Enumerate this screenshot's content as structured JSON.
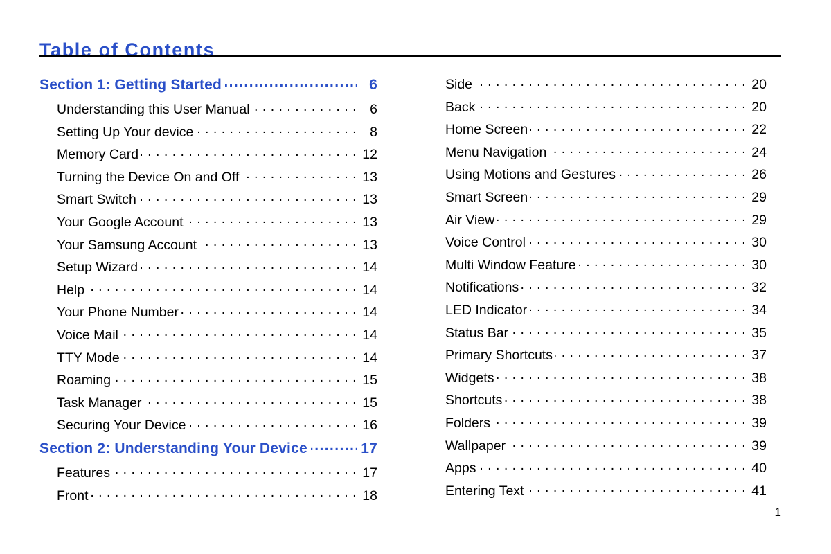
{
  "document": {
    "title": "Table of Contents",
    "footer_page_number": "1",
    "accent_color": "#2a4fc8",
    "text_color": "#000000",
    "background_color": "#ffffff",
    "rule_color": "#000000"
  },
  "left_column": {
    "rows": [
      {
        "type": "section",
        "label": "Section 1:  Getting Started",
        "page": "6"
      },
      {
        "type": "entry",
        "label": "Understanding this User Manual",
        "page": "6"
      },
      {
        "type": "entry",
        "label": "Setting Up Your device",
        "page": "8"
      },
      {
        "type": "entry",
        "label": "Memory Card",
        "page": "12"
      },
      {
        "type": "entry",
        "label": "Turning the Device On and Off",
        "page": "13"
      },
      {
        "type": "entry",
        "label": "Smart Switch",
        "page": "13"
      },
      {
        "type": "entry",
        "label": "Your Google Account",
        "page": "13"
      },
      {
        "type": "entry",
        "label": "Your Samsung Account",
        "page": "13"
      },
      {
        "type": "entry",
        "label": "Setup Wizard",
        "page": "14"
      },
      {
        "type": "entry",
        "label": "Help",
        "page": "14"
      },
      {
        "type": "entry",
        "label": "Your Phone Number",
        "page": "14"
      },
      {
        "type": "entry",
        "label": "Voice Mail",
        "page": "14"
      },
      {
        "type": "entry",
        "label": "TTY Mode",
        "page": "14"
      },
      {
        "type": "entry",
        "label": "Roaming",
        "page": "15"
      },
      {
        "type": "entry",
        "label": "Task Manager",
        "page": "15"
      },
      {
        "type": "entry",
        "label": "Securing Your Device",
        "page": "16"
      },
      {
        "type": "section",
        "label": "Section 2:  Understanding Your Device",
        "page": "17"
      },
      {
        "type": "entry",
        "label": "Features",
        "page": "17"
      },
      {
        "type": "entry",
        "label": "Front",
        "page": "18"
      }
    ]
  },
  "right_column": {
    "rows": [
      {
        "type": "entry",
        "label": "Side",
        "page": "20"
      },
      {
        "type": "entry",
        "label": "Back",
        "page": "20"
      },
      {
        "type": "entry",
        "label": "Home Screen",
        "page": "22"
      },
      {
        "type": "entry",
        "label": "Menu Navigation",
        "page": "24"
      },
      {
        "type": "entry",
        "label": "Using Motions and Gestures",
        "page": "26"
      },
      {
        "type": "entry",
        "label": "Smart Screen",
        "page": "29"
      },
      {
        "type": "entry",
        "label": "Air View",
        "page": "29"
      },
      {
        "type": "entry",
        "label": "Voice Control",
        "page": "30"
      },
      {
        "type": "entry",
        "label": "Multi Window Feature",
        "page": "30"
      },
      {
        "type": "entry",
        "label": "Notifications",
        "page": "32"
      },
      {
        "type": "entry",
        "label": "LED Indicator",
        "page": "34"
      },
      {
        "type": "entry",
        "label": "Status Bar",
        "page": "35"
      },
      {
        "type": "entry",
        "label": "Primary Shortcuts",
        "page": "37"
      },
      {
        "type": "entry",
        "label": "Widgets",
        "page": "38"
      },
      {
        "type": "entry",
        "label": "Shortcuts",
        "page": "38"
      },
      {
        "type": "entry",
        "label": "Folders",
        "page": "39"
      },
      {
        "type": "entry",
        "label": "Wallpaper",
        "page": "39"
      },
      {
        "type": "entry",
        "label": "Apps",
        "page": "40"
      },
      {
        "type": "entry",
        "label": "Entering Text",
        "page": "41"
      }
    ]
  }
}
